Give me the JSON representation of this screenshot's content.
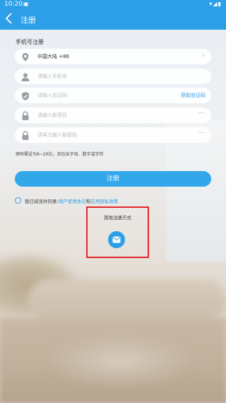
{
  "status_bar": {
    "time": "10:20",
    "notification_icon": "gallery-icon",
    "right_icons": "▾◢▮"
  },
  "app_bar": {
    "title": "注册"
  },
  "form": {
    "section_label": "手机号注册",
    "region": {
      "value": "中国大陆 +86"
    },
    "phone": {
      "placeholder": "请输入手机号"
    },
    "code": {
      "placeholder": "请输入验证码",
      "action_label": "获取验证码"
    },
    "password": {
      "placeholder": "请输入新密码"
    },
    "password_confirm": {
      "placeholder": "请再次输入新密码"
    },
    "hint": "密码需设为8~20位，且包含字母、数字或字符",
    "register_label": "注册"
  },
  "agreement": {
    "prefix": "我已阅读并同意:",
    "user_agreement": "用户使用协议",
    "conjunction": "和",
    "privacy_policy": "应用隐私政策"
  },
  "other_methods": {
    "label": "其他注册方式",
    "email_icon": "mail-icon"
  },
  "colors": {
    "primary": "#2d9fe8",
    "button": "#32a8ea",
    "highlight_box": "#e0262a"
  }
}
